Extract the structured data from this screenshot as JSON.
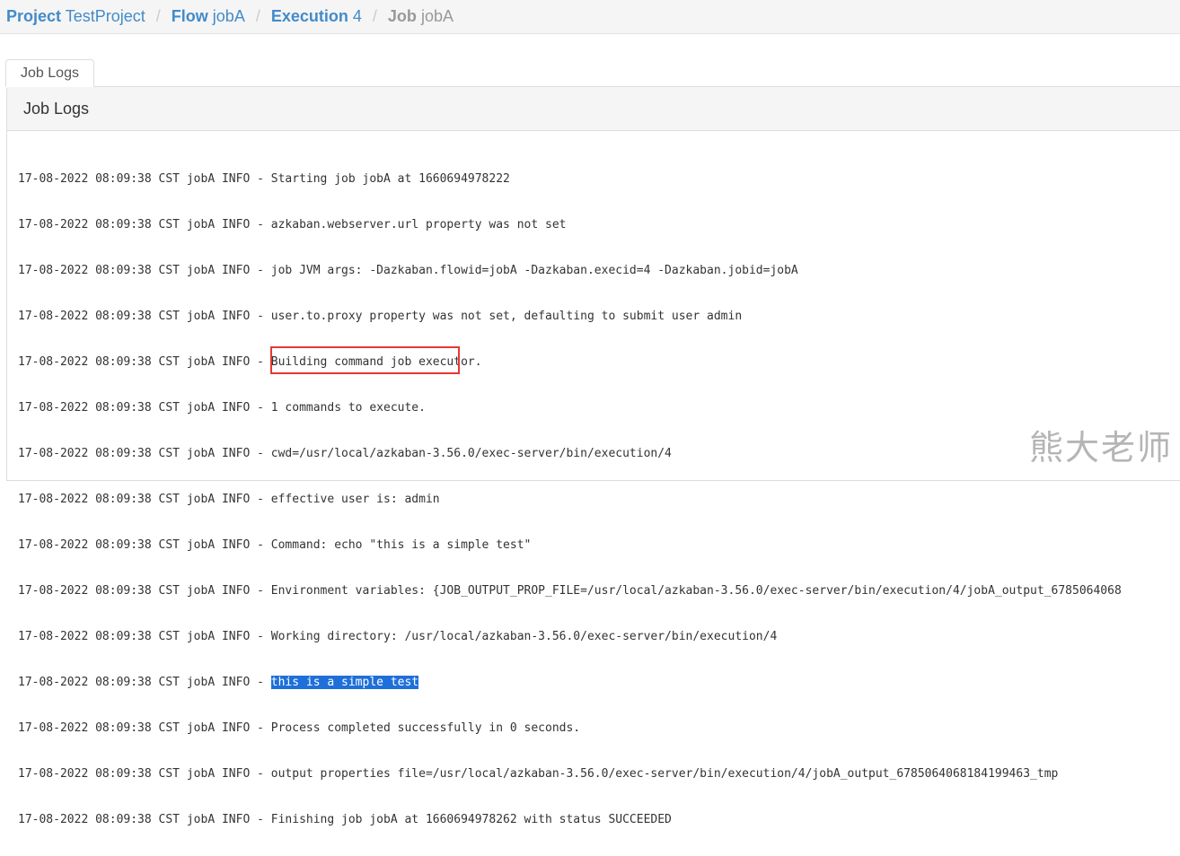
{
  "breadcrumb": {
    "project": {
      "label": "Project",
      "name": "TestProject"
    },
    "flow": {
      "label": "Flow",
      "name": "jobA"
    },
    "execution": {
      "label": "Execution",
      "name": "4"
    },
    "job": {
      "label": "Job",
      "name": "jobA"
    },
    "separator": "/"
  },
  "tabs": [
    {
      "label": "Job Logs",
      "active": true
    }
  ],
  "panel": {
    "title": "Job Logs"
  },
  "log": {
    "lines": [
      "17-08-2022 08:09:38 CST jobA INFO - Starting job jobA at 1660694978222",
      "17-08-2022 08:09:38 CST jobA INFO - azkaban.webserver.url property was not set",
      "17-08-2022 08:09:38 CST jobA INFO - job JVM args: -Dazkaban.flowid=jobA -Dazkaban.execid=4 -Dazkaban.jobid=jobA",
      "17-08-2022 08:09:38 CST jobA INFO - user.to.proxy property was not set, defaulting to submit user admin",
      "17-08-2022 08:09:38 CST jobA INFO - Building command job executor.",
      "17-08-2022 08:09:38 CST jobA INFO - 1 commands to execute.",
      "17-08-2022 08:09:38 CST jobA INFO - cwd=/usr/local/azkaban-3.56.0/exec-server/bin/execution/4",
      "17-08-2022 08:09:38 CST jobA INFO - effective user is: admin",
      "17-08-2022 08:09:38 CST jobA INFO - Command: echo \"this is a simple test\"",
      "17-08-2022 08:09:38 CST jobA INFO - Environment variables: {JOB_OUTPUT_PROP_FILE=/usr/local/azkaban-3.56.0/exec-server/bin/execution/4/jobA_output_6785064068",
      "17-08-2022 08:09:38 CST jobA INFO - Working directory: /usr/local/azkaban-3.56.0/exec-server/bin/execution/4",
      "17-08-2022 08:09:38 CST jobA INFO - ",
      "17-08-2022 08:09:38 CST jobA INFO - Process completed successfully in 0 seconds.",
      "17-08-2022 08:09:38 CST jobA INFO - output properties file=/usr/local/azkaban-3.56.0/exec-server/bin/execution/4/jobA_output_6785064068184199463_tmp",
      "17-08-2022 08:09:38 CST jobA INFO - Finishing job jobA at 1660694978262 with status SUCCEEDED"
    ],
    "selected_text": "this is a simple test"
  },
  "watermark": "熊大老师",
  "colors": {
    "link": "#428bca",
    "selection": "#1e6fd9",
    "annotation": "#e53935"
  }
}
